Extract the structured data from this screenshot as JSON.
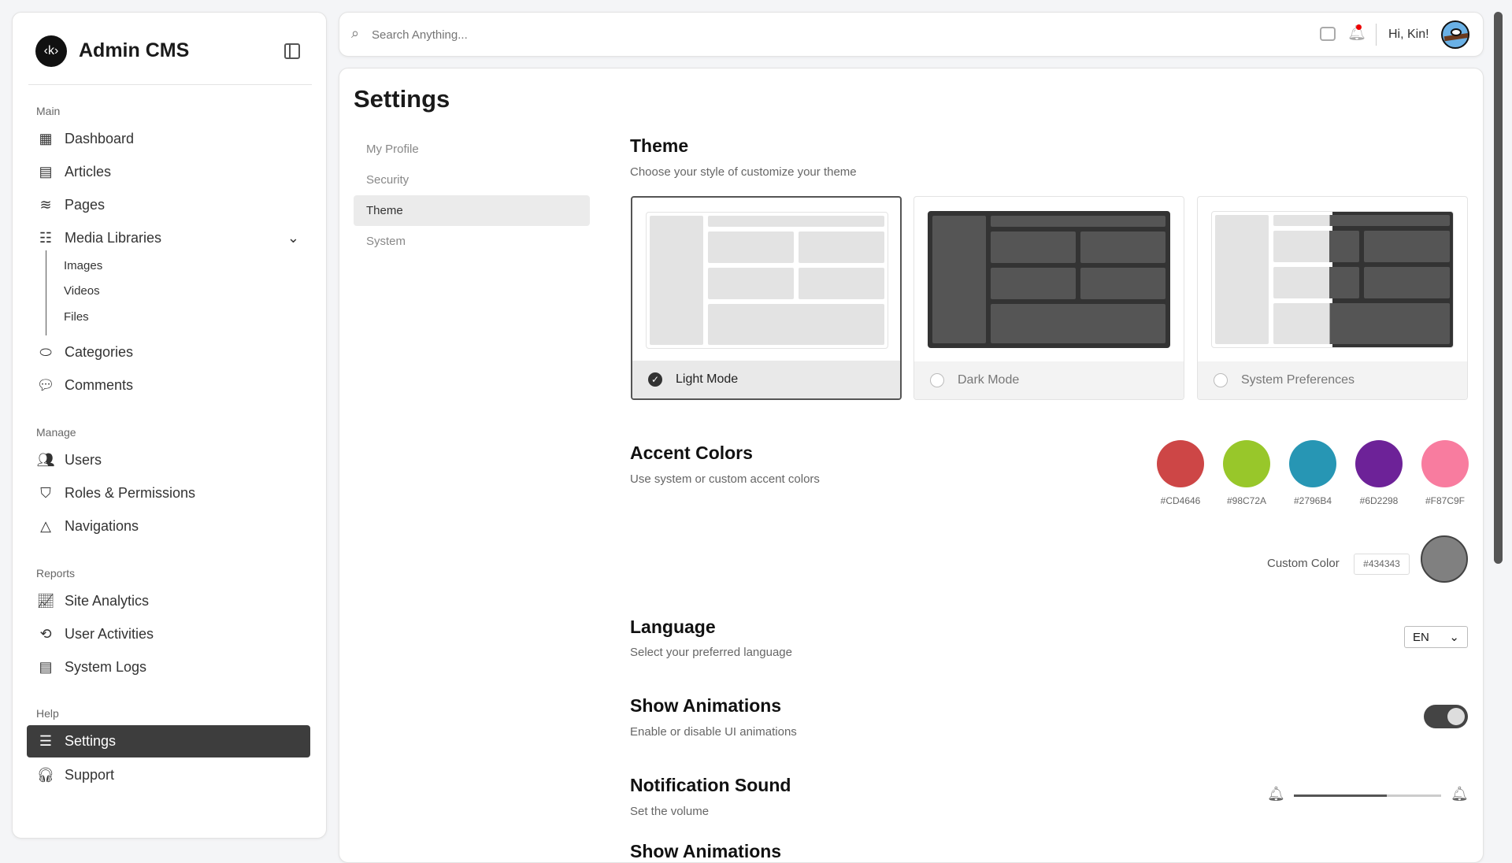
{
  "app": {
    "title": "Admin CMS",
    "logo_text": "‹k›"
  },
  "sidebar": {
    "sections": {
      "main": "Main",
      "manage": "Manage",
      "reports": "Reports",
      "help": "Help"
    },
    "items": {
      "dashboard": "Dashboard",
      "articles": "Articles",
      "pages": "Pages",
      "media": "Media Libraries",
      "images": "Images",
      "videos": "Videos",
      "files": "Files",
      "categories": "Categories",
      "comments": "Comments",
      "users": "Users",
      "roles": "Roles & Permissions",
      "navigations": "Navigations",
      "analytics": "Site Analytics",
      "activities": "User Activities",
      "logs": "System Logs",
      "settings": "Settings",
      "support": "Support"
    }
  },
  "topbar": {
    "search_placeholder": "Search Anything...",
    "greeting": "Hi, Kin!"
  },
  "settings": {
    "title": "Settings",
    "subnav": [
      "My Profile",
      "Security",
      "Theme",
      "System"
    ],
    "theme": {
      "title": "Theme",
      "desc": "Choose your style of customize your theme",
      "options": [
        "Light Mode",
        "Dark Mode",
        "System Preferences"
      ],
      "selected": "Light Mode"
    },
    "accent": {
      "title": "Accent Colors",
      "desc": "Use system or custom accent colors",
      "colors": [
        "#CD4646",
        "#98C72A",
        "#2796B4",
        "#6D2298",
        "#F87C9F"
      ],
      "custom_label": "Custom Color",
      "custom_value": "#434343"
    },
    "language": {
      "title": "Language",
      "desc": "Select your preferred language",
      "value": "EN"
    },
    "animations": {
      "title": "Show Animations",
      "desc": "Enable or disable UI animations",
      "enabled": true
    },
    "sound": {
      "title": "Notification Sound",
      "desc": "Set the volume",
      "volume_percent": 63
    },
    "next_section": "Show Animations"
  }
}
